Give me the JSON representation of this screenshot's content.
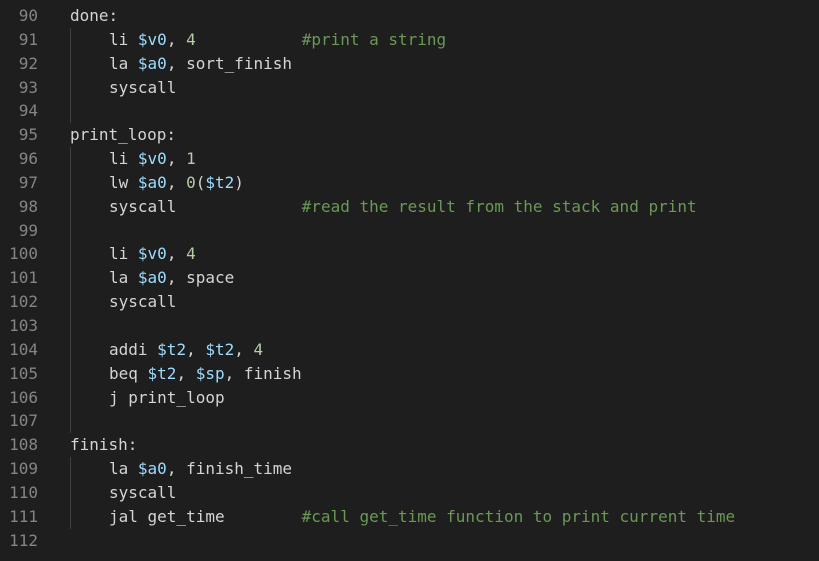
{
  "colors": {
    "background": "#1e1e1e",
    "line_number": "#858585",
    "text": "#d4d4d4",
    "register": "#9cdcfe",
    "number": "#b5cea8",
    "comment": "#6a9955",
    "indent_guide": "#404040"
  },
  "lines": [
    {
      "number": "90",
      "indented": false,
      "tokens": [
        {
          "t": "done:",
          "k": "plain"
        }
      ]
    },
    {
      "number": "91",
      "indented": true,
      "tokens": [
        {
          "t": "li ",
          "k": "plain"
        },
        {
          "t": "$v0",
          "k": "reg"
        },
        {
          "t": ", ",
          "k": "plain"
        },
        {
          "t": "4",
          "k": "num"
        },
        {
          "t": "           ",
          "k": "plain"
        },
        {
          "t": "#print a string",
          "k": "comment"
        }
      ]
    },
    {
      "number": "92",
      "indented": true,
      "tokens": [
        {
          "t": "la ",
          "k": "plain"
        },
        {
          "t": "$a0",
          "k": "reg"
        },
        {
          "t": ", sort_finish",
          "k": "plain"
        }
      ]
    },
    {
      "number": "93",
      "indented": true,
      "tokens": [
        {
          "t": "syscall",
          "k": "plain"
        }
      ]
    },
    {
      "number": "94",
      "indented": true,
      "tokens": []
    },
    {
      "number": "95",
      "indented": false,
      "tokens": [
        {
          "t": "print_loop:",
          "k": "plain"
        }
      ]
    },
    {
      "number": "96",
      "indented": true,
      "tokens": [
        {
          "t": "li ",
          "k": "plain"
        },
        {
          "t": "$v0",
          "k": "reg"
        },
        {
          "t": ", ",
          "k": "plain"
        },
        {
          "t": "1",
          "k": "num"
        }
      ]
    },
    {
      "number": "97",
      "indented": true,
      "tokens": [
        {
          "t": "lw ",
          "k": "plain"
        },
        {
          "t": "$a0",
          "k": "reg"
        },
        {
          "t": ", ",
          "k": "plain"
        },
        {
          "t": "0",
          "k": "num"
        },
        {
          "t": "(",
          "k": "plain"
        },
        {
          "t": "$t2",
          "k": "reg"
        },
        {
          "t": ")",
          "k": "plain"
        }
      ]
    },
    {
      "number": "98",
      "indented": true,
      "tokens": [
        {
          "t": "syscall",
          "k": "plain"
        },
        {
          "t": "             ",
          "k": "plain"
        },
        {
          "t": "#read the result from the stack and print",
          "k": "comment"
        }
      ]
    },
    {
      "number": "99",
      "indented": true,
      "tokens": []
    },
    {
      "number": "100",
      "indented": true,
      "tokens": [
        {
          "t": "li ",
          "k": "plain"
        },
        {
          "t": "$v0",
          "k": "reg"
        },
        {
          "t": ", ",
          "k": "plain"
        },
        {
          "t": "4",
          "k": "num"
        }
      ]
    },
    {
      "number": "101",
      "indented": true,
      "tokens": [
        {
          "t": "la ",
          "k": "plain"
        },
        {
          "t": "$a0",
          "k": "reg"
        },
        {
          "t": ", space",
          "k": "plain"
        }
      ]
    },
    {
      "number": "102",
      "indented": true,
      "tokens": [
        {
          "t": "syscall",
          "k": "plain"
        }
      ]
    },
    {
      "number": "103",
      "indented": true,
      "tokens": []
    },
    {
      "number": "104",
      "indented": true,
      "tokens": [
        {
          "t": "addi ",
          "k": "plain"
        },
        {
          "t": "$t2",
          "k": "reg"
        },
        {
          "t": ", ",
          "k": "plain"
        },
        {
          "t": "$t2",
          "k": "reg"
        },
        {
          "t": ", ",
          "k": "plain"
        },
        {
          "t": "4",
          "k": "num"
        }
      ]
    },
    {
      "number": "105",
      "indented": true,
      "tokens": [
        {
          "t": "beq ",
          "k": "plain"
        },
        {
          "t": "$t2",
          "k": "reg"
        },
        {
          "t": ", ",
          "k": "plain"
        },
        {
          "t": "$sp",
          "k": "reg"
        },
        {
          "t": ", finish",
          "k": "plain"
        }
      ]
    },
    {
      "number": "106",
      "indented": true,
      "tokens": [
        {
          "t": "j print_loop",
          "k": "plain"
        }
      ]
    },
    {
      "number": "107",
      "indented": true,
      "tokens": []
    },
    {
      "number": "108",
      "indented": false,
      "tokens": [
        {
          "t": "finish:",
          "k": "plain"
        }
      ]
    },
    {
      "number": "109",
      "indented": true,
      "tokens": [
        {
          "t": "la ",
          "k": "plain"
        },
        {
          "t": "$a0",
          "k": "reg"
        },
        {
          "t": ", finish_time",
          "k": "plain"
        }
      ]
    },
    {
      "number": "110",
      "indented": true,
      "tokens": [
        {
          "t": "syscall",
          "k": "plain"
        }
      ]
    },
    {
      "number": "111",
      "indented": true,
      "tokens": [
        {
          "t": "jal get_time",
          "k": "plain"
        },
        {
          "t": "        ",
          "k": "plain"
        },
        {
          "t": "#call get_time function to print current time",
          "k": "comment"
        }
      ]
    },
    {
      "number": "112",
      "indented": false,
      "tokens": []
    }
  ]
}
